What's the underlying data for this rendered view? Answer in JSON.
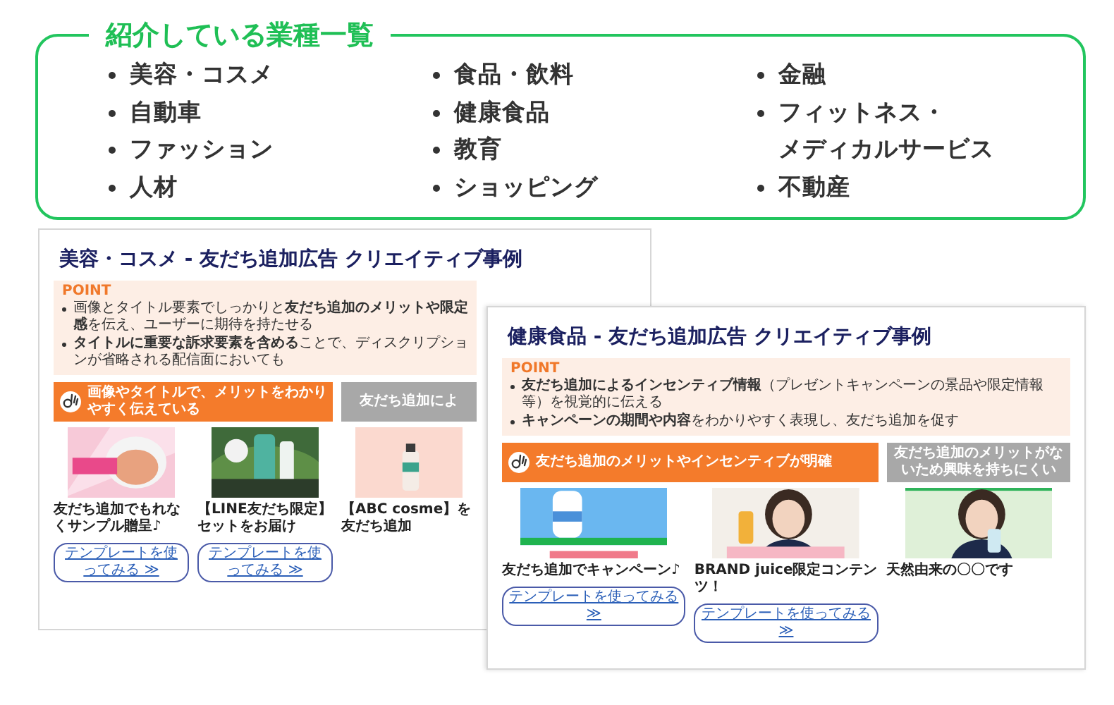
{
  "industries": {
    "title": "紹介している業種一覧",
    "columns": [
      [
        "美容・コスメ",
        "自動車",
        "ファッション",
        "人材"
      ],
      [
        "食品・飲料",
        "健康食品",
        "教育",
        "ショッピング"
      ],
      [
        "金融",
        "フィットネス・メディカルサービス",
        "不動産"
      ]
    ]
  },
  "slides": [
    {
      "title": "美容・コスメ - 友だち追加広告 クリエイティブ事例",
      "point_label": "POINT",
      "points": [
        "画像とタイトル要素でしっかりと**友だち追加のメリットや限定感**を伝え、ユーザーに期待を持たせる",
        "**タイトルに重要な訴求要素を含める**ことで、ディスクリプションが省略される配信面においても"
      ],
      "banners": [
        {
          "kind": "good",
          "label": "画像やタイトルで、メリットをわかりやすく伝えている"
        },
        {
          "kind": "bad",
          "label": "友だち追加によ"
        }
      ],
      "cards": [
        {
          "caption": "友だち追加でもれなくサンプル贈呈♪",
          "button": "テンプレートを使ってみる ≫"
        },
        {
          "caption": "【LINE友だち限定】セットをお届け",
          "button": "テンプレートを使ってみる ≫"
        },
        {
          "caption": "【ABC cosme】を友だち追加"
        }
      ]
    },
    {
      "title": "健康食品 - 友だち追加広告 クリエイティブ事例",
      "point_label": "POINT",
      "points": [
        "**友だち追加によるインセンティブ情報**（プレゼントキャンペーンの景品や限定情報等）を視覚的に伝える",
        "**キャンペーンの期間や内容**をわかりやすく表現し、友だち追加を促す"
      ],
      "banners": [
        {
          "kind": "good",
          "label": "友だち追加のメリットやインセンティブが明確"
        },
        {
          "kind": "bad",
          "label": "友だち追加のメリットがないため興味を持ちにくい"
        }
      ],
      "cards": [
        {
          "caption": "友だち追加でキャンペーン♪",
          "button": "テンプレートを使ってみる ≫"
        },
        {
          "caption": "BRAND juice限定コンテンツ！",
          "button": "テンプレートを使ってみる ≫"
        },
        {
          "caption": "天然由来の〇〇です"
        }
      ]
    }
  ]
}
